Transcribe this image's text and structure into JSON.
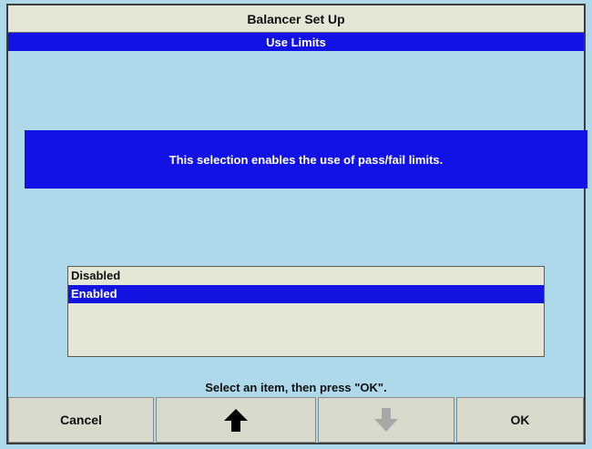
{
  "window": {
    "title": "Balancer Set Up",
    "subtitle": "Use Limits"
  },
  "info": {
    "message": "This selection enables the use of pass/fail limits."
  },
  "options": {
    "items": [
      {
        "label": "Disabled",
        "selected": false
      },
      {
        "label": "Enabled",
        "selected": true
      }
    ]
  },
  "prompt": {
    "text": "Select an item, then press \"OK\"."
  },
  "buttons": {
    "cancel": "Cancel",
    "up_icon": "arrow-up-icon",
    "down_icon": "arrow-down-icon",
    "ok": "OK"
  },
  "colors": {
    "background": "#add9ea",
    "accent_blue": "#1212e6",
    "panel": "#e4e6d6",
    "button": "#d8dacb",
    "arrow_active": "#000000",
    "arrow_disabled": "#a8a8a8"
  }
}
